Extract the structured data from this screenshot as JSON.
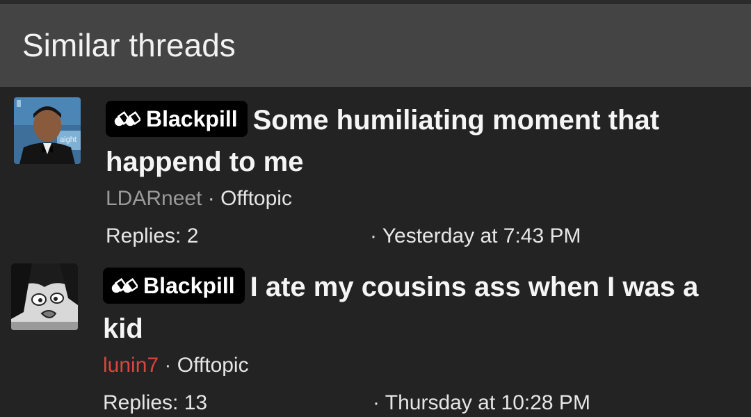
{
  "header": {
    "title": "Similar threads"
  },
  "threads": [
    {
      "prefix": "Blackpill",
      "title": "Some humiliating moment that happend to me",
      "author": "LDARneet",
      "separator": "·",
      "forum": "Offtopic",
      "replies": "Replies: 2",
      "date": "· Yesterday at 7:43 PM",
      "author_color": "#9a9a9a"
    },
    {
      "prefix": "Blackpill",
      "title": "I ate my cousins ass when I was a kid",
      "author": "lunin7",
      "separator": "·",
      "forum": "Offtopic",
      "replies": "Replies: 13",
      "date": "· Thursday at 10:28 PM",
      "author_color": "#d9463f"
    }
  ]
}
